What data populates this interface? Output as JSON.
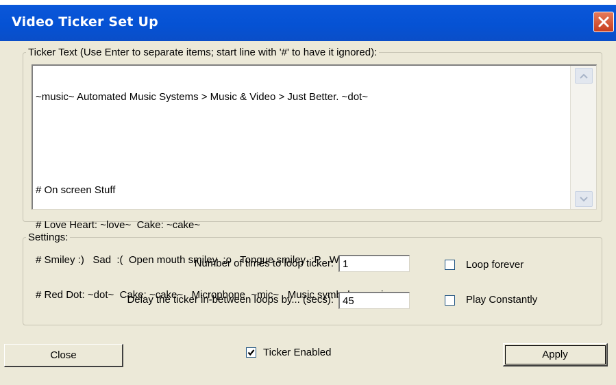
{
  "window": {
    "title": "Video Ticker Set Up"
  },
  "ticker_group": {
    "legend": "Ticker Text (Use Enter to separate items; start line with '#' to have it ignored):",
    "text_lines": [
      "~music~ Automated Music Systems > Music & Video > Just Better. ~dot~",
      "",
      "# On screen Stuff",
      "# Love Heart: ~love~  Cake: ~cake~",
      "# Smiley :)   Sad  :(  Open mouth smiley  :o   Tongue smiley  :P   Wink smiley  ;)",
      "# Red Dot: ~dot~  Cake: ~cake~   Microphone  ~mic~   Music symbol  ~music~"
    ]
  },
  "settings_group": {
    "legend": "Settings:",
    "loop_label": "Number of times to loop ticker:",
    "loop_value": "1",
    "delay_label": "Delay the ticker in-between loops by... (secs):",
    "delay_value": "45",
    "loop_forever_label": "Loop forever",
    "loop_forever_checked": false,
    "play_constantly_label": "Play Constantly",
    "play_constantly_checked": false
  },
  "footer": {
    "close_label": "Close",
    "ticker_enabled_label": "Ticker Enabled",
    "ticker_enabled_checked": true,
    "apply_label": "Apply"
  },
  "icons": {
    "close": "close-x-icon",
    "scroll_up": "chevron-up-icon",
    "scroll_down": "chevron-down-icon",
    "checkmark": "checkmark-icon"
  },
  "colors": {
    "titlebar": "#0552d4",
    "close_button": "#c73e1f",
    "window_bg": "#ece9d8"
  }
}
